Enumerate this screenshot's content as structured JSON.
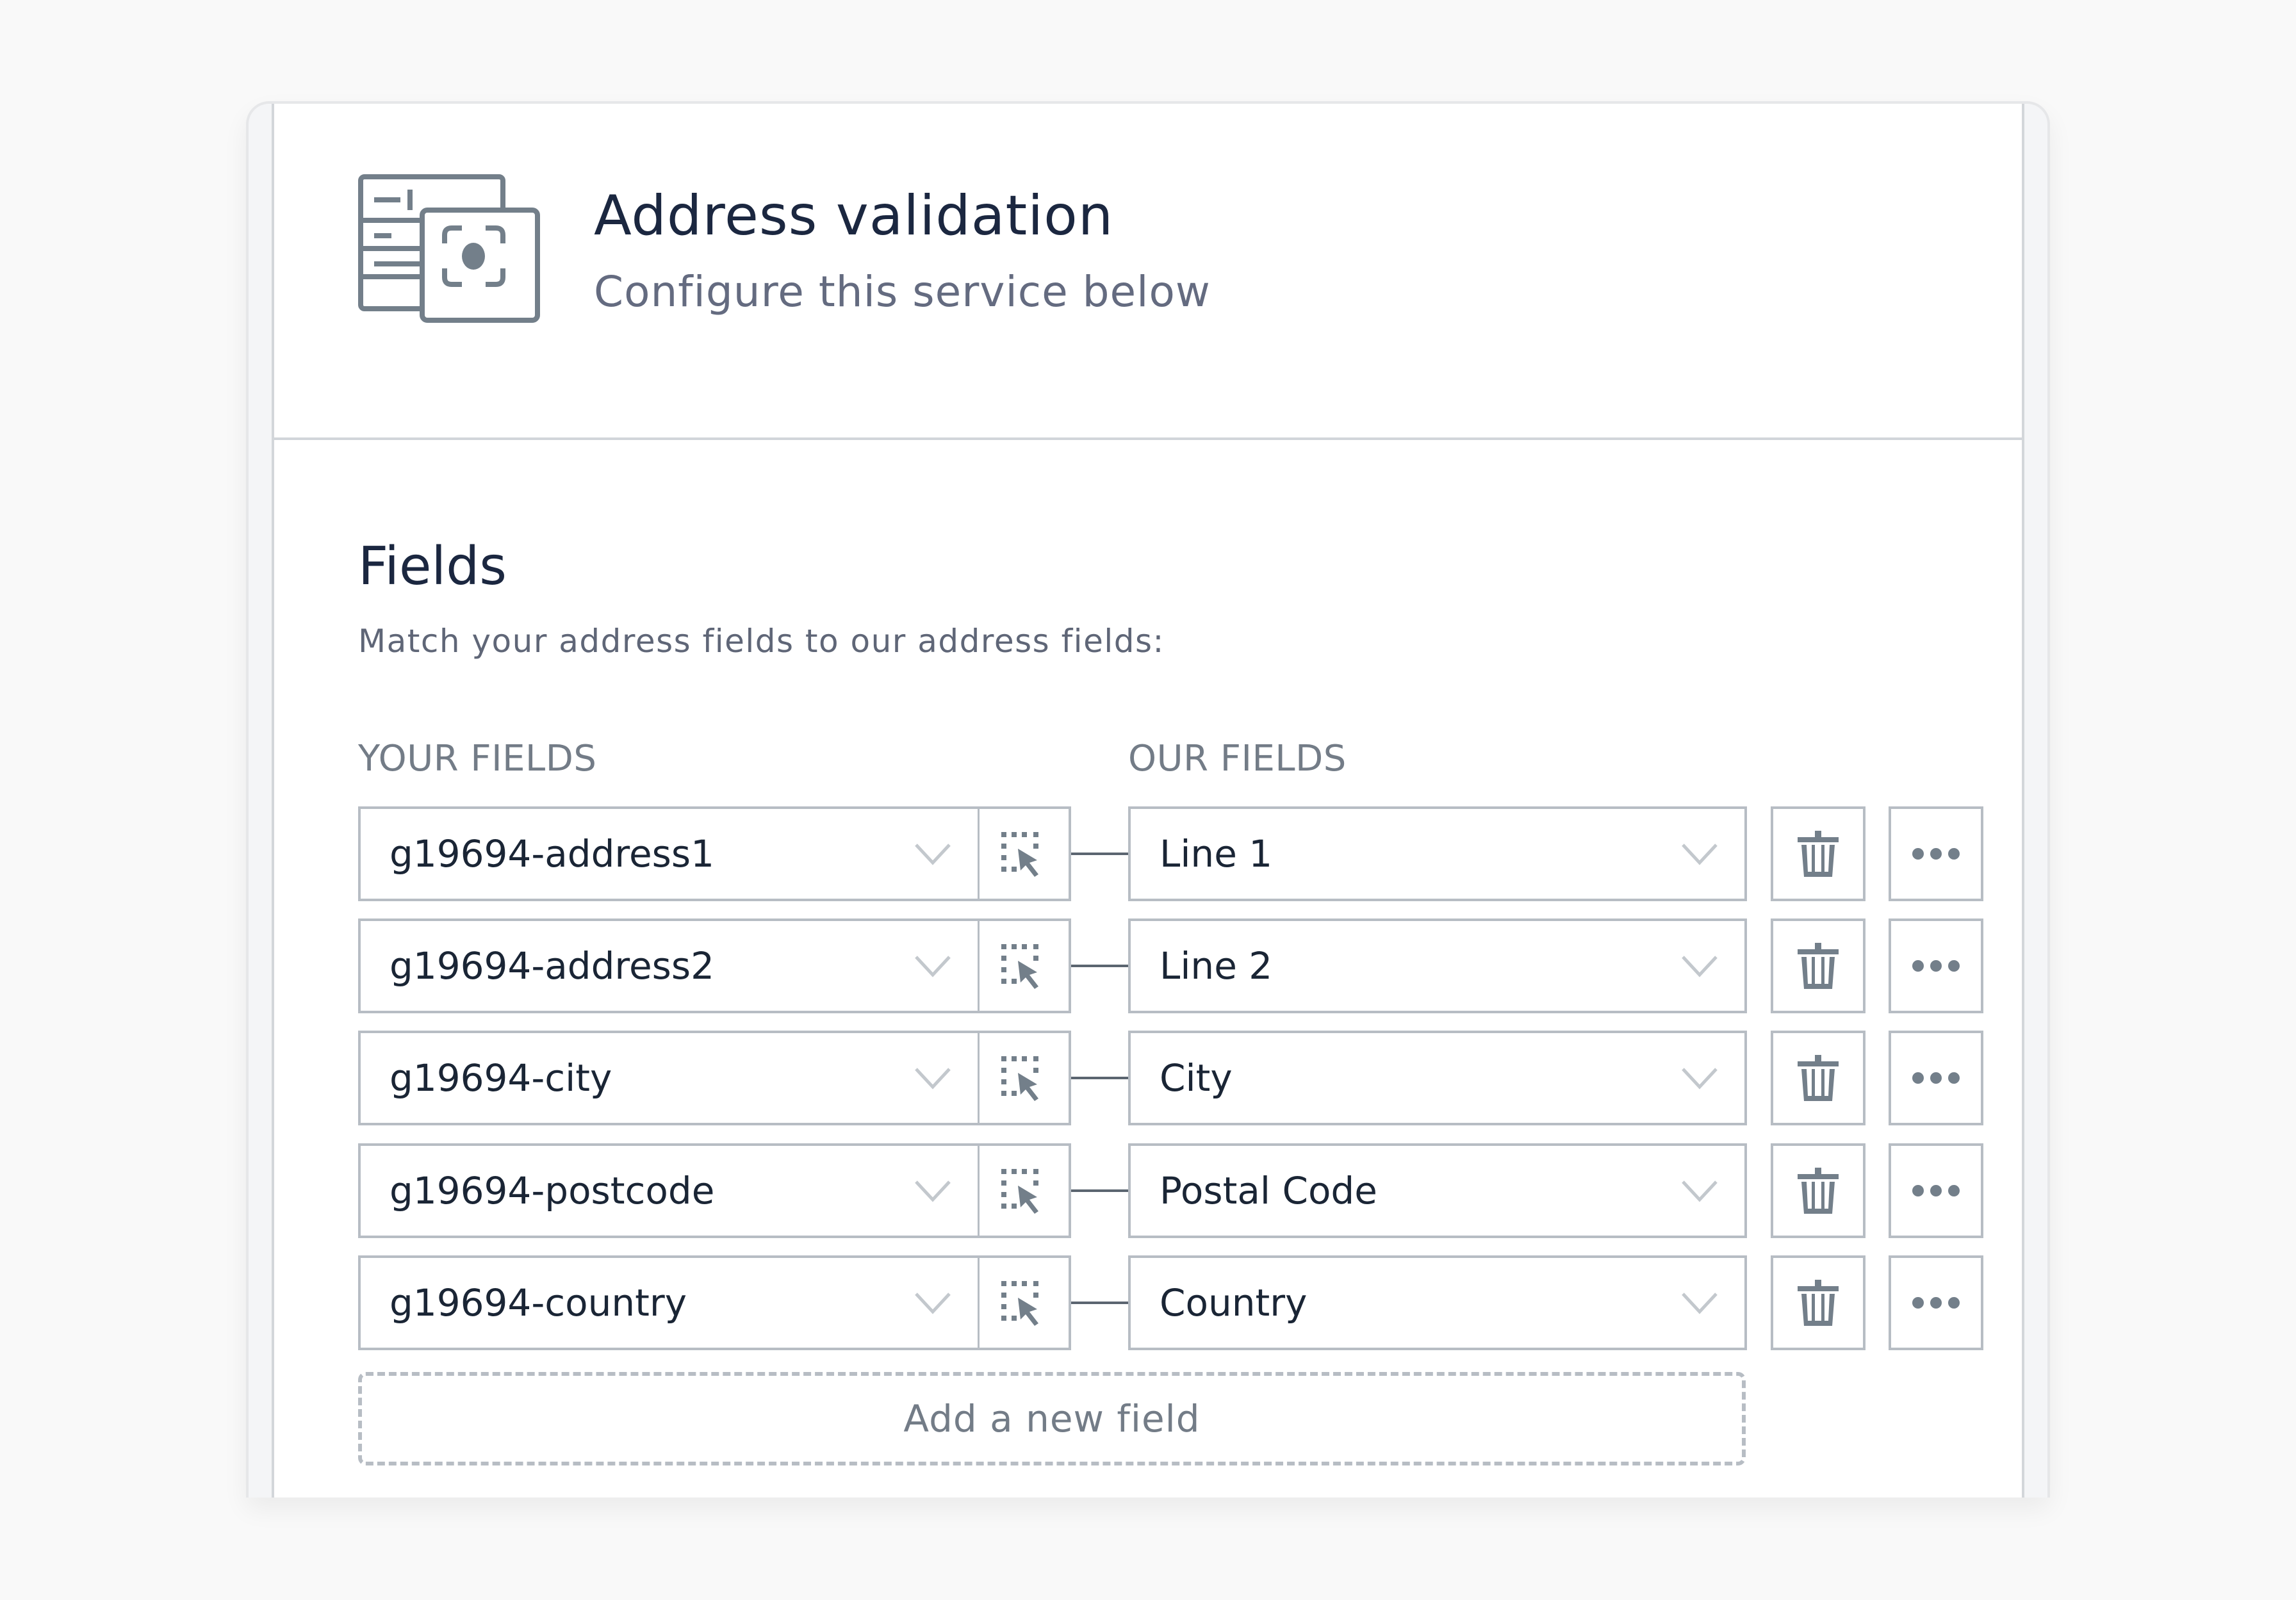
{
  "header": {
    "icon": "address-validation-service-icon",
    "title": "Address validation",
    "subtitle": "Configure this service below"
  },
  "fields_section": {
    "title": "Fields",
    "description": "Match your address fields to our address fields:",
    "your_fields_label": "YOUR FIELDS",
    "our_fields_label": "OUR FIELDS",
    "rows": [
      {
        "your_field": "g19694-address1",
        "our_field": "Line 1"
      },
      {
        "your_field": "g19694-address2",
        "our_field": "Line 2"
      },
      {
        "your_field": "g19694-city",
        "our_field": "City"
      },
      {
        "your_field": "g19694-postcode",
        "our_field": "Postal Code"
      },
      {
        "your_field": "g19694-country",
        "our_field": "Country"
      }
    ],
    "icons": {
      "dropdown": "chevron-down-icon",
      "picker": "element-picker-icon",
      "delete": "trash-icon",
      "more": "more-horizontal-icon"
    },
    "add_button_label": "Add a new field"
  },
  "colors": {
    "page_bg": "#f9f9f9",
    "heading": "#1b2740",
    "muted_text": "#646b80",
    "border": "#b7bdc4",
    "icon_gray": "#737f8a"
  }
}
